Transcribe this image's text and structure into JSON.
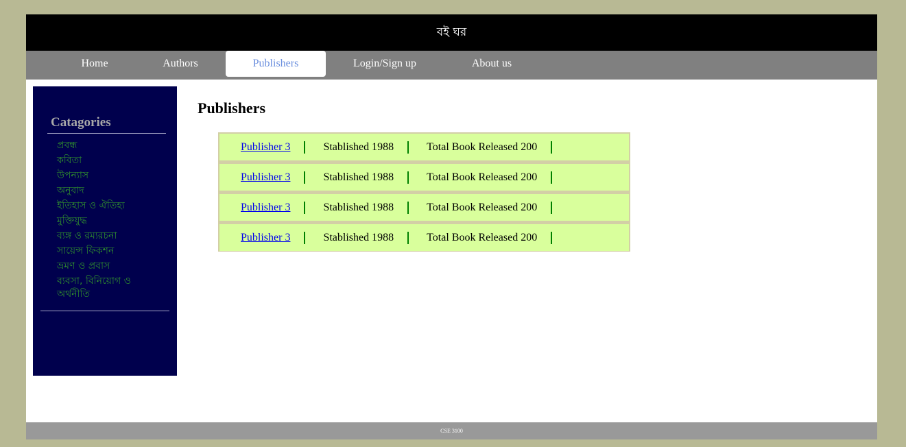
{
  "header": {
    "title": "বই ঘর"
  },
  "nav": {
    "items": [
      {
        "label": "Home"
      },
      {
        "label": "Authors"
      },
      {
        "label": "Publishers"
      },
      {
        "label": "Login/Sign up"
      },
      {
        "label": "About us"
      }
    ],
    "active": "Publishers"
  },
  "sidebar": {
    "title": "Catagories",
    "categories": [
      "প্রবন্ধ",
      "কবিতা",
      "উপন্যাস",
      "অনুবাদ",
      "ইতিহাস ও ঐতিহ্য",
      "মুক্তিযুদ্ধ",
      "ব্যঙ্গ ও রম্যরচনা",
      "সায়েন্স ফিকশন",
      "ভ্রমণ ও প্রবাস",
      "ব্যবসা, বিনিয়োগ ও অর্থনীতি"
    ]
  },
  "main": {
    "title": "Publishers",
    "publishers": [
      {
        "name": "Publisher 3",
        "established": "Stablished 1988",
        "total": "Total Book Released 200"
      },
      {
        "name": "Publisher 3",
        "established": "Stablished 1988",
        "total": "Total Book Released 200"
      },
      {
        "name": "Publisher 3",
        "established": "Stablished 1988",
        "total": "Total Book Released 200"
      },
      {
        "name": "Publisher 3",
        "established": "Stablished 1988",
        "total": "Total Book Released 200"
      }
    ]
  },
  "footer": {
    "text": "CSE 3100"
  },
  "colors": {
    "background": "#b8b994",
    "header": "#000000",
    "nav": "#808080",
    "active_nav_text": "#6b8fde",
    "sidebar": "#00004d",
    "category_text": "#2e8b2e",
    "row_background": "#d9ff9c",
    "row_separator": "#008000",
    "footer": "#999999"
  }
}
